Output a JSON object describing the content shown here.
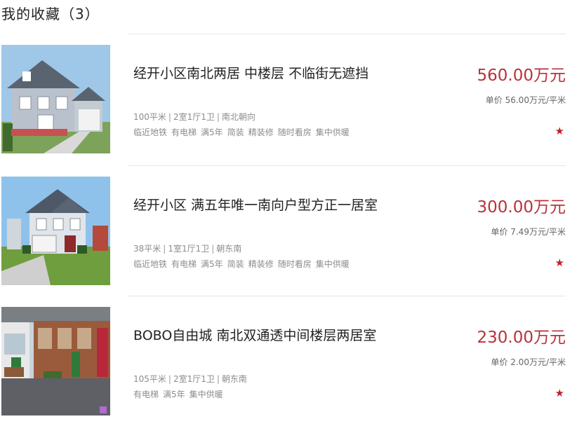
{
  "page": {
    "title": "我的收藏（3）"
  },
  "favorites": [
    {
      "title": "经开小区南北两居 中楼层 不临街无遮挡",
      "area": "100平米",
      "layout": "2室1厅1卫",
      "orientation": "南北朝向",
      "tags": [
        "临近地铁",
        "有电梯",
        "满5年",
        "简装",
        "精装修",
        "随时看房",
        "集中供暖"
      ],
      "price": "560.00万元",
      "unit_price": "单价 56.00万元/平米",
      "star": "★"
    },
    {
      "title": "经开小区 满五年唯一南向户型方正一居室",
      "area": "38平米",
      "layout": "1室1厅1卫",
      "orientation": "朝东南",
      "tags": [
        "临近地铁",
        "有电梯",
        "满5年",
        "简装",
        "精装修",
        "随时看房",
        "集中供暖"
      ],
      "price": "300.00万元",
      "unit_price": "单价 7.49万元/平米",
      "star": "★"
    },
    {
      "title": "BOBO自由城 南北双通透中间楼层两居室",
      "area": "105平米",
      "layout": "2室1厅1卫",
      "orientation": "朝东南",
      "tags": [
        "有电梯",
        "满5年",
        "集中供暖"
      ],
      "price": "230.00万元",
      "unit_price": "单价 2.00万元/平米",
      "star": "★"
    }
  ],
  "colors": {
    "price": "#b8323c",
    "star": "#c0202c",
    "muted_text": "#8c8c8c"
  },
  "icons": {
    "favorite": "star-icon"
  }
}
